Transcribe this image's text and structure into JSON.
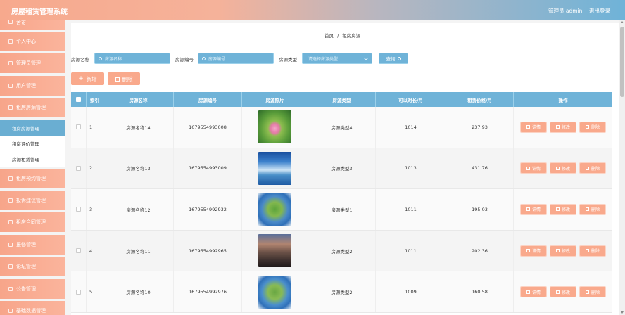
{
  "header": {
    "title": "房屋租赁管理系统",
    "admin_label": "管理员 admin",
    "logout": "退出登录"
  },
  "sidebar": {
    "items": [
      {
        "label": "首页"
      },
      {
        "label": "个人中心"
      },
      {
        "label": "管理员管理"
      },
      {
        "label": "用户管理"
      },
      {
        "label": "租房房源管理"
      }
    ],
    "subitems": [
      {
        "label": "租房房源管理",
        "active": true
      },
      {
        "label": "租房评价管理",
        "active": false
      },
      {
        "label": "房源租赁管理",
        "active": false
      }
    ],
    "items_after": [
      {
        "label": "租房预约管理"
      },
      {
        "label": "投诉建议管理"
      },
      {
        "label": "租房合同管理"
      },
      {
        "label": "报修管理"
      },
      {
        "label": "论坛管理"
      },
      {
        "label": "公告管理"
      },
      {
        "label": "基础数据管理"
      }
    ]
  },
  "breadcrumb": {
    "home": "首页",
    "sep": "/",
    "current": "租房房源"
  },
  "search": {
    "name_label": "房源名称",
    "name_placeholder": "房源名称",
    "code_label": "房源编号",
    "code_placeholder": "房源编号",
    "type_label": "房源类型",
    "type_placeholder": "请选择房源类型",
    "query_button": "查询"
  },
  "toolbar": {
    "add_label": "新增",
    "delete_label": "删除"
  },
  "table": {
    "headers": [
      "索引",
      "房源名称",
      "房源编号",
      "房源照片",
      "房源类型",
      "可以时长/月",
      "租赁价格/月",
      "操作"
    ],
    "rows": [
      {
        "index": "1",
        "name": "房源名称14",
        "code": "1679554993008",
        "photo": "lotus-photo",
        "type": "房源类型4",
        "duration": "1014",
        "price": "237.93"
      },
      {
        "index": "2",
        "name": "房源名称13",
        "code": "1679554993009",
        "photo": "ocean-photo",
        "type": "房源类型3",
        "duration": "1013",
        "price": "431.76"
      },
      {
        "index": "3",
        "name": "房源名称12",
        "code": "1679554992932",
        "photo": "planet-photo",
        "type": "房源类型1",
        "duration": "1011",
        "price": "195.03"
      },
      {
        "index": "4",
        "name": "房源名称11",
        "code": "1679554992965",
        "photo": "city-photo",
        "type": "房源类型2",
        "duration": "1011",
        "price": "202.36"
      },
      {
        "index": "5",
        "name": "房源名称10",
        "code": "1679554992976",
        "photo": "planet-photo",
        "type": "房源类型2",
        "duration": "1009",
        "price": "160.58"
      }
    ],
    "actions": {
      "detail": "详情",
      "edit": "修改",
      "delete": "删除"
    }
  },
  "colors": {
    "primary": "#6fb3d8",
    "accent": "#f9a98c"
  }
}
